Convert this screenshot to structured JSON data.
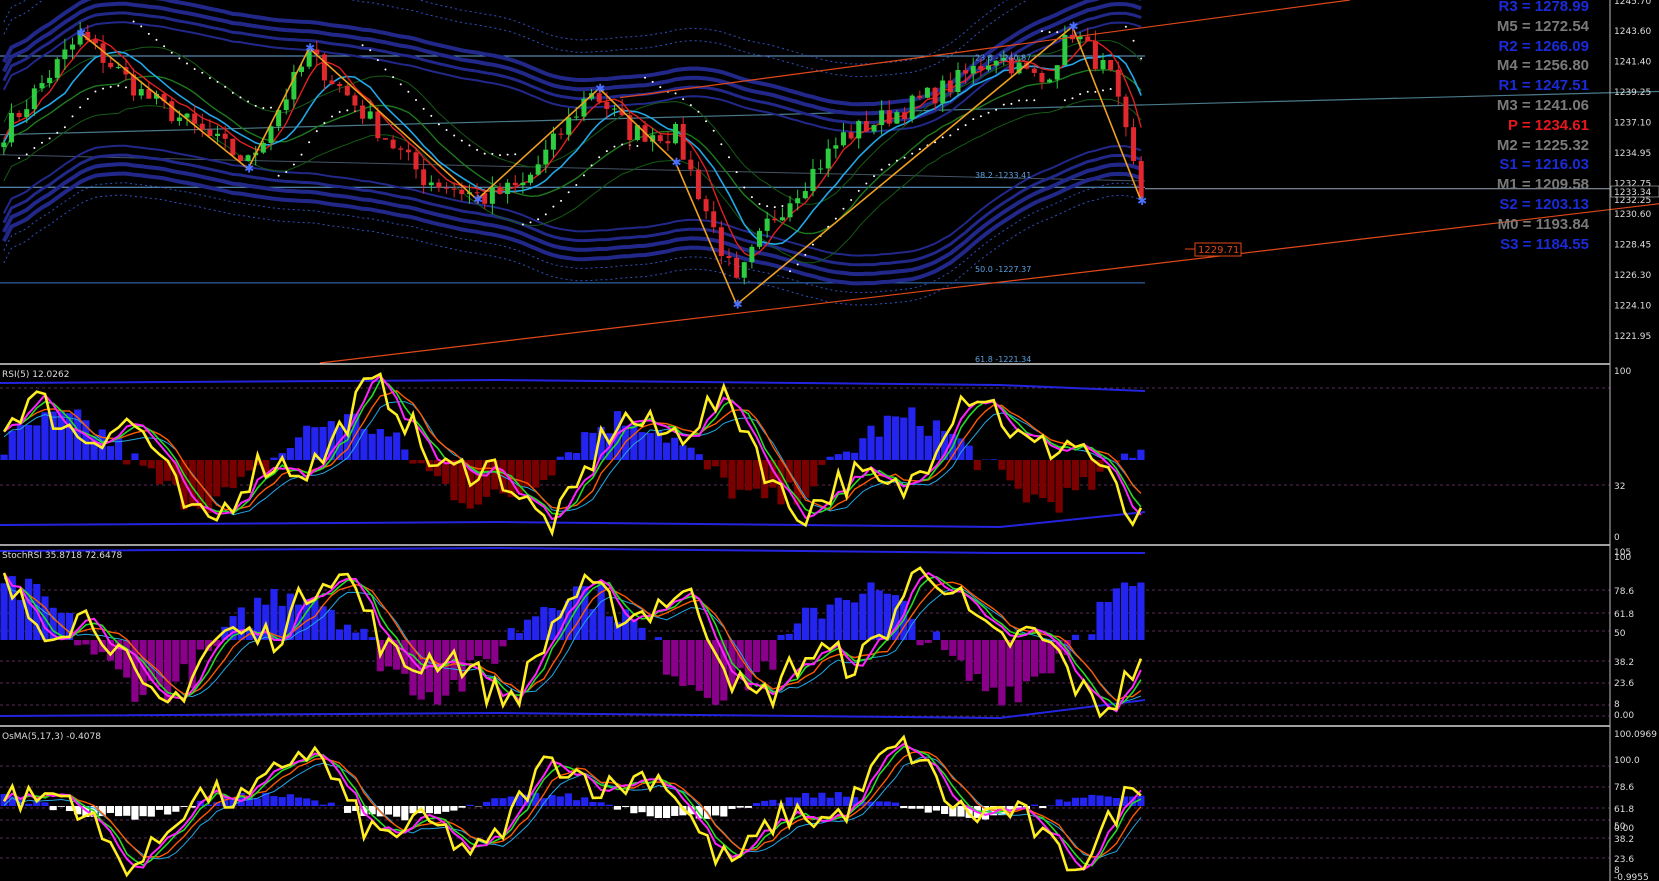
{
  "chart_data": {
    "type": "line",
    "main": {
      "price_ticks": [
        "1243.60",
        "1241.40",
        "1239.25",
        "1237.10",
        "1234.95",
        "1232.75",
        "1230.60",
        "1228.45",
        "1226.30",
        "1224.10",
        "1221.95"
      ],
      "price_min": 1221.95,
      "price_max": 1245.2,
      "current_price": "1233.34",
      "label_1229": "1229.71",
      "fib_labels": [
        "23.6 -1240.87",
        "38.2 -1233.41",
        "50.0 -1227.37",
        "61.8 -1221.34"
      ],
      "top_tick": "1245.70",
      "axis_flags": [
        "1232.75",
        "1232.25"
      ]
    },
    "rsi": {
      "title": "RSI(5) 12.0262",
      "ticks": [
        "100",
        "32",
        "0"
      ]
    },
    "stochrsi": {
      "title": "StochRSI 35.8718 72.6478",
      "ticks": [
        "105",
        "100",
        "78.6",
        "61.8",
        "50",
        "38.2",
        "23.6",
        "8",
        "0.00"
      ]
    },
    "osma": {
      "title": "OsMA(5,17,3) -0.4078",
      "ticks": [
        "100.0969",
        "100.0",
        "78.6",
        "61.8",
        "50",
        "0.00",
        "38.2",
        "23.6",
        "8",
        "-0.9955"
      ]
    }
  },
  "pivots": [
    {
      "label": "R3 = 1278.99",
      "color": "#1b2bd8"
    },
    {
      "label": "M5 = 1272.54",
      "color": "#7a7a7a"
    },
    {
      "label": "R2 = 1266.09",
      "color": "#1b2bd8"
    },
    {
      "label": "M4 = 1256.80",
      "color": "#7a7a7a"
    },
    {
      "label": "R1 = 1247.51",
      "color": "#1b2bd8"
    },
    {
      "label": "M3 = 1241.06",
      "color": "#7a7a7a"
    },
    {
      "label": "P  = 1234.61",
      "color": "#e8171d"
    },
    {
      "label": "M2 = 1225.32",
      "color": "#7a7a7a"
    },
    {
      "label": "S1 = 1216.03",
      "color": "#1b2bd8"
    },
    {
      "label": "M1 = 1209.58",
      "color": "#7a7a7a"
    },
    {
      "label": "S2 = 1203.13",
      "color": "#1b2bd8"
    },
    {
      "label": "M0 = 1193.84",
      "color": "#7a7a7a"
    },
    {
      "label": "S3 = 1184.55",
      "color": "#1b2bd8"
    }
  ],
  "colors": {
    "up": "#2ecc40",
    "down": "#e0282e",
    "zigzag": "#f0a020",
    "trend": "#e04818",
    "env": "#22288a",
    "hist_blue": "#2424f0",
    "hist_red": "#7a0000",
    "hist_purple": "#8a008a",
    "line_yellow": "#ffee22",
    "line_magenta": "#ff22ff",
    "line_green": "#22dd22",
    "line_orange": "#ff5a00",
    "line_cyan": "#22a8e8"
  }
}
